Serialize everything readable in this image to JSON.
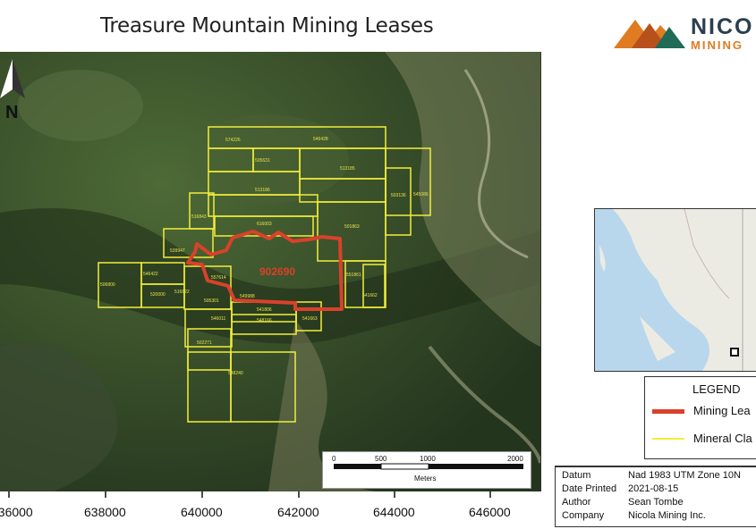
{
  "title": "Treasure Mountain Mining Leases",
  "logo": {
    "line1": "NICO",
    "line2": "MINING"
  },
  "north_arrow": {
    "label": "N",
    "icon": "north-arrow-icon"
  },
  "map": {
    "lease": {
      "id": "902690",
      "color": "#d9412b"
    },
    "claim_color": "#f2ee3a",
    "claims": [
      "574226",
      "546428",
      "505631",
      "513185",
      "513186",
      "503136",
      "545086",
      "516843",
      "616003",
      "501863",
      "539947",
      "546422",
      "506800",
      "520000",
      "516822",
      "557614",
      "505301",
      "546011",
      "541663",
      "541806",
      "548166",
      "502271",
      "548240",
      "551861",
      "541662",
      "549988"
    ]
  },
  "scale": {
    "ticks": [
      "0",
      "500",
      "1000",
      "2000"
    ],
    "unit": "Meters"
  },
  "x_axis": {
    "ticks": [
      "636000",
      "638000",
      "640000",
      "642000",
      "644000",
      "646000"
    ]
  },
  "legend": {
    "title": "LEGEND",
    "items": [
      {
        "label": "Mining Lea",
        "color": "#d9412b"
      },
      {
        "label": "Mineral Cla",
        "color": "#f2ee3a"
      }
    ]
  },
  "info": [
    {
      "key": "Datum",
      "value": "Nad 1983 UTM Zone 10N"
    },
    {
      "key": "Date Printed",
      "value": "2021-08-15"
    },
    {
      "key": "Author",
      "value": "Sean Tombe"
    },
    {
      "key": "Company",
      "value": "Nicola Mining Inc."
    }
  ]
}
